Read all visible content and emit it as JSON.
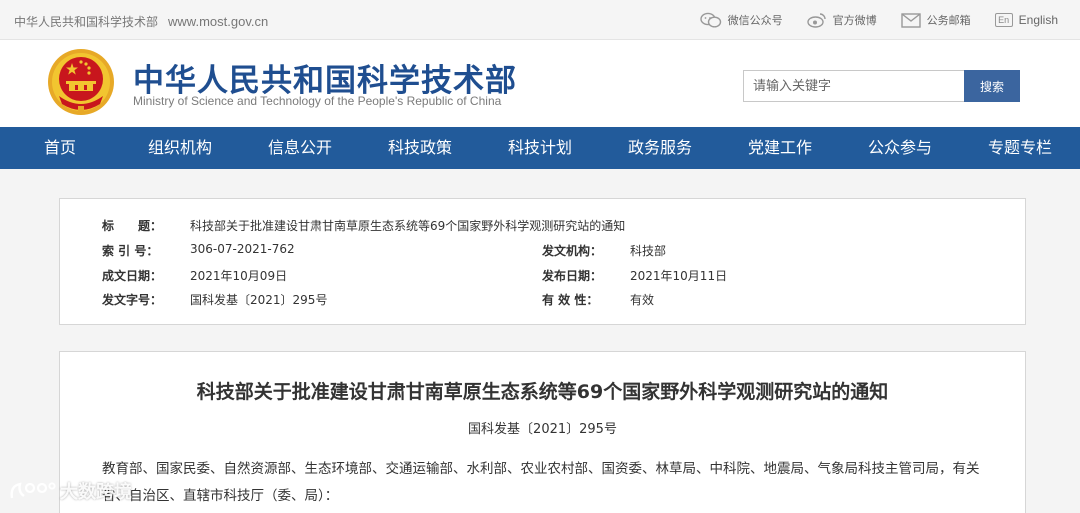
{
  "topbar": {
    "site_name": "中华人民共和国科学技术部",
    "url": "www.most.gov.cn",
    "links": [
      {
        "label": "微信公众号",
        "icon": "wechat-icon"
      },
      {
        "label": "官方微博",
        "icon": "weibo-icon"
      },
      {
        "label": "公务邮箱",
        "icon": "mail-icon"
      },
      {
        "label": "English",
        "icon": "en-icon",
        "icon_text": "En"
      }
    ]
  },
  "header": {
    "title_cn": "中华人民共和国科学技术部",
    "title_en": "Ministry of Science and Technology of the People's Republic of China",
    "search_placeholder": "请输入关键字",
    "search_button": "搜索"
  },
  "nav": {
    "items": [
      "首页",
      "组织机构",
      "信息公开",
      "科技政策",
      "科技计划",
      "政务服务",
      "党建工作",
      "公众参与",
      "专题专栏"
    ]
  },
  "meta": {
    "title_label": "标　　题：",
    "title_value": "科技部关于批准建设甘肃甘南草原生态系统等69个国家野外科学观测研究站的通知",
    "index_label": "索 引 号：",
    "index_value": "306-07-2021-762",
    "issuer_label": "发文机构：",
    "issuer_value": "科技部",
    "written_label": "成文日期：",
    "written_value": "2021年10月09日",
    "published_label": "发布日期：",
    "published_value": "2021年10月11日",
    "docno_label": "发文字号：",
    "docno_value": "国科发基〔2021〕295号",
    "validity_label": "有 效 性：",
    "validity_value": "有效"
  },
  "article": {
    "title": "科技部关于批准建设甘肃甘南草原生态系统等69个国家野外科学观测研究站的通知",
    "doc_number": "国科发基〔2021〕295号",
    "body": "教育部、国家民委、自然资源部、生态环境部、交通运输部、水利部、农业农村部、国资委、林草局、中科院、地震局、气象局科技主管司局，有关省、自治区、直辖市科技厅（委、局）："
  },
  "watermark": {
    "text": "大数跨境"
  },
  "colors": {
    "nav_bg": "#225b9b",
    "title_blue": "#1f4e90",
    "search_button_bg": "#3b659f",
    "emblem_red": "#c8161d",
    "emblem_gold": "#f2c530"
  }
}
